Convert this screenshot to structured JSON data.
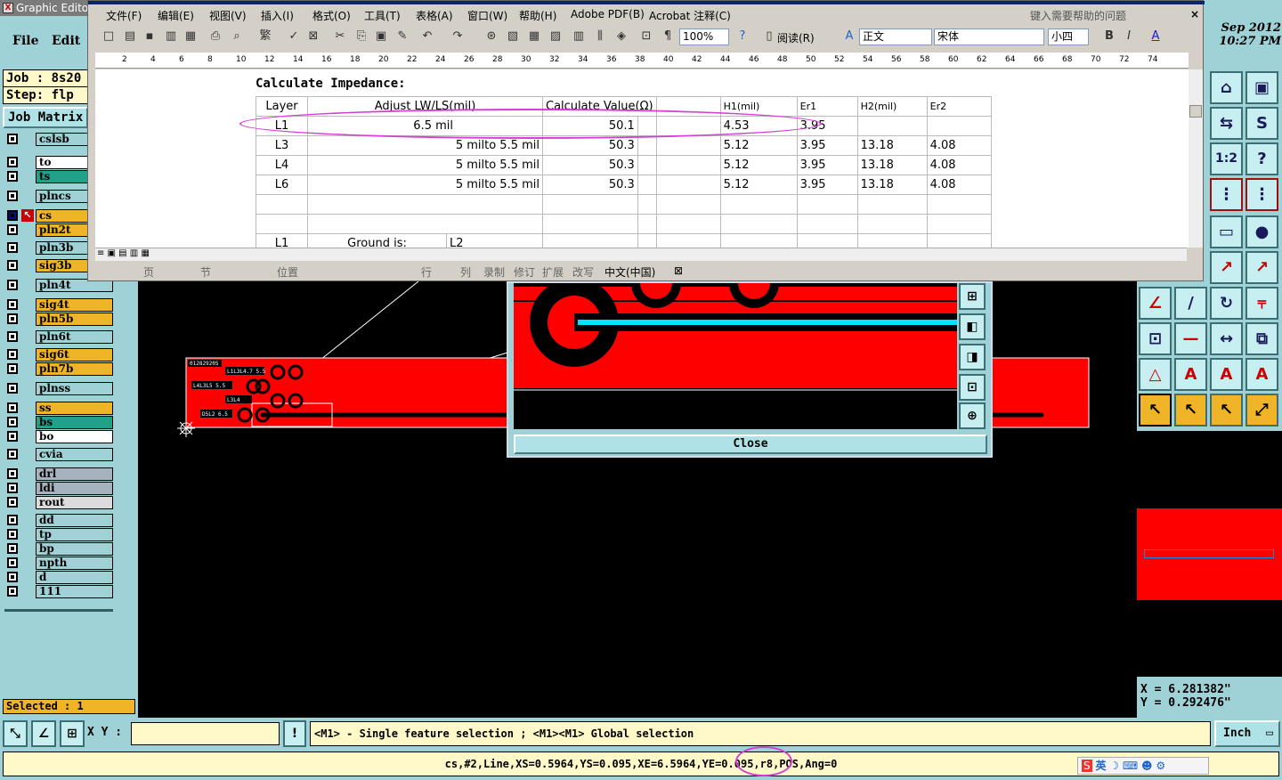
{
  "app": {
    "title": "Graphic Editor",
    "menu": [
      "File",
      "Edit"
    ],
    "job_label": "Job : 8s20",
    "step_label": "Step: flp",
    "job_matrix": "Job Matrix",
    "selected": "Selected : 1"
  },
  "layers": [
    {
      "name": "cslsb",
      "color": "#9fd2d6"
    },
    {
      "name": "to",
      "color": "#ffffff"
    },
    {
      "name": "ts",
      "color": "#21a08a"
    },
    {
      "name": "plncs",
      "color": "#9fd2d6"
    },
    {
      "name": "cs",
      "color": "#f0b429",
      "active": true
    },
    {
      "name": "pln2t",
      "color": "#f0b429"
    },
    {
      "name": "pln3b",
      "color": "#9fd2d6"
    },
    {
      "name": "sig3b",
      "color": "#f0b429"
    },
    {
      "name": "pln4t",
      "color": "#9fd2d6"
    },
    {
      "name": "sig4t",
      "color": "#f0b429"
    },
    {
      "name": "pln5b",
      "color": "#f0b429"
    },
    {
      "name": "pln6t",
      "color": "#9fd2d6"
    },
    {
      "name": "sig6t",
      "color": "#f0b429"
    },
    {
      "name": "pln7b",
      "color": "#f0b429"
    },
    {
      "name": "plnss",
      "color": "#9fd2d6"
    },
    {
      "name": "ss",
      "color": "#f0b429"
    },
    {
      "name": "bs",
      "color": "#21a08a"
    },
    {
      "name": "bo",
      "color": "#ffffff"
    },
    {
      "name": "cvia",
      "color": "#9fd2d6"
    },
    {
      "name": "drl",
      "color": "#a4b3bd"
    },
    {
      "name": "ldi",
      "color": "#a4b3bd"
    },
    {
      "name": "rout",
      "color": "#dcdcdc"
    },
    {
      "name": "dd",
      "color": "#9fd2d6"
    },
    {
      "name": "tp",
      "color": "#9fd2d6"
    },
    {
      "name": "bp",
      "color": "#9fd2d6"
    },
    {
      "name": "npth",
      "color": "#9fd2d6"
    },
    {
      "name": "d",
      "color": "#9fd2d6"
    },
    {
      "name": "111",
      "color": "#9fd2d6"
    }
  ],
  "word": {
    "menu": [
      "文件(F)",
      "编辑(E)",
      "视图(V)",
      "插入(I)",
      "格式(O)",
      "工具(T)",
      "表格(A)",
      "窗口(W)",
      "帮助(H)",
      "Adobe PDF(B)",
      "Acrobat 注释(C)"
    ],
    "help_placeholder": "键入需要帮助的问题",
    "zoom": "100%",
    "read_btn": "阅读(R)",
    "style": "正文",
    "font": "宋体",
    "size": "小四",
    "ruler": [
      "2",
      "4",
      "6",
      "8",
      "10",
      "12",
      "14",
      "16",
      "18",
      "20",
      "22",
      "24",
      "26",
      "28",
      "30",
      "32",
      "34",
      "36",
      "38",
      "40",
      "42",
      "44",
      "46",
      "48",
      "50",
      "52",
      "54",
      "56",
      "58",
      "60",
      "62",
      "64",
      "66",
      "68",
      "70",
      "72",
      "74"
    ],
    "status": [
      "页",
      "节",
      "位置",
      "行",
      "列",
      "录制",
      "修订",
      "扩展",
      "改写",
      "中文(中国)"
    ],
    "table": {
      "title": "Calculate Impedance:",
      "headers": [
        "Layer",
        "Adjust LW/LS(mil)",
        "Calculate Value(Ω)",
        "H1(mil)",
        "Er1",
        "H2(mil)",
        "Er2"
      ],
      "rows": [
        {
          "layer": "L1",
          "lw": "6.5 mil",
          "val": "50.1",
          "h1": "4.53",
          "er1": "3.95",
          "h2": "",
          "er2": ""
        },
        {
          "layer": "L3",
          "lw": "5 milto  5.5 mil",
          "val": "50.3",
          "h1": "5.12",
          "er1": "3.95",
          "h2": "13.18",
          "er2": "4.08"
        },
        {
          "layer": "L4",
          "lw": "5 milto  5.5 mil",
          "val": "50.3",
          "h1": "5.12",
          "er1": "3.95",
          "h2": "13.18",
          "er2": "4.08"
        },
        {
          "layer": "L6",
          "lw": "5 milto  5.5 mil",
          "val": "50.3",
          "h1": "5.12",
          "er1": "3.95",
          "h2": "13.18",
          "er2": "4.08"
        }
      ],
      "footer": {
        "layer": "L1",
        "ground": "Ground is:",
        "ref": "L2"
      }
    }
  },
  "datetime": {
    "date": "Sep 2012",
    "time": "10:27 PM"
  },
  "coords": {
    "x": "X = 6.281382\"",
    "y": "Y = 0.292476\""
  },
  "popup": {
    "close": "Close"
  },
  "bottom": {
    "xy_label": "X Y :",
    "xy_value": "",
    "hint": "<M1> - Single feature selection ; <M1><M1> Global selection",
    "unit": "Inch",
    "feature": "cs,#2,Line,XS=0.5964,YS=0.095,XE=6.5964,YE=0.095,r8,POS,Ang=0",
    "ime": "英"
  },
  "pcb_labels": [
    "01282920S",
    "L1L3L4.7 5.5",
    "L4L3L5 5.5",
    "L3L4",
    "D5L2 6.5"
  ]
}
